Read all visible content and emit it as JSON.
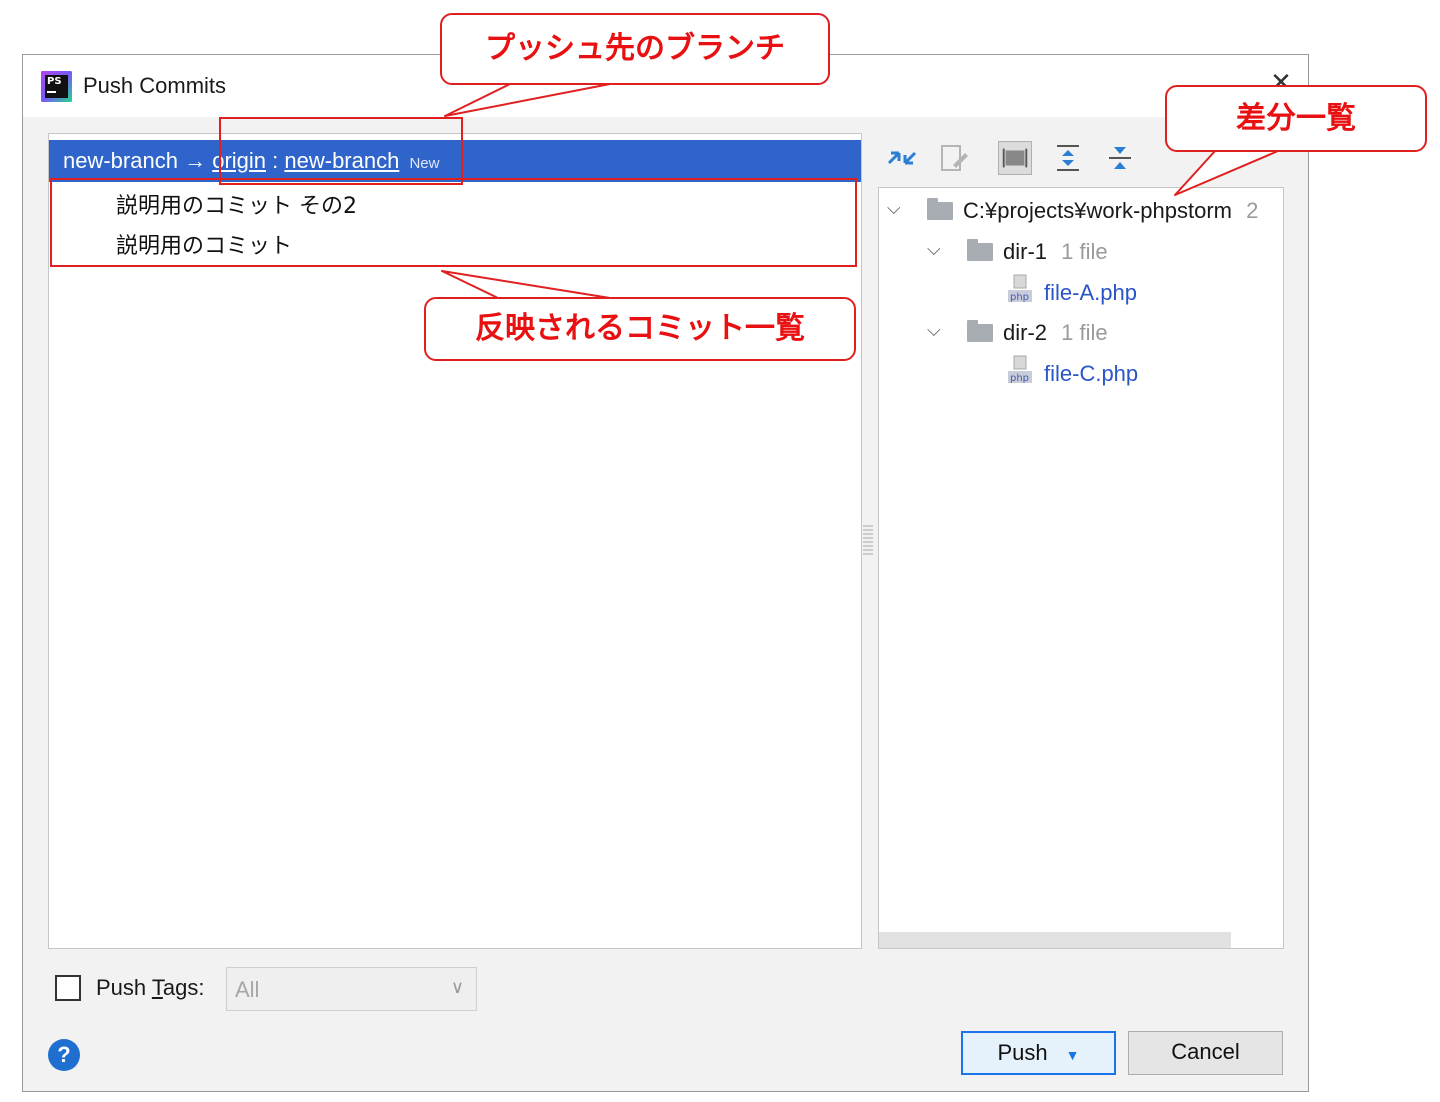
{
  "window": {
    "title": "Push Commits",
    "close": "✕",
    "app_icon": "phpstorm-logo"
  },
  "branch": {
    "local": "new-branch",
    "arrow": "→",
    "remote": "origin",
    "separator": ":",
    "target": "new-branch",
    "badge": "New"
  },
  "commits": [
    {
      "message": "説明用のコミット その2"
    },
    {
      "message": "説明用のコミット"
    }
  ],
  "toolbar": {
    "icons": [
      "show-diff-icon",
      "edit-source-icon",
      "group-by-directory-icon",
      "expand-all-icon",
      "collapse-all-icon"
    ]
  },
  "tree": {
    "root": {
      "label": "C:¥projects¥work-phpstorm",
      "count": "2"
    },
    "dirs": [
      {
        "label": "dir-1",
        "count": "1 file",
        "file": "file-A.php"
      },
      {
        "label": "dir-2",
        "count": "1 file",
        "file": "file-C.php"
      }
    ]
  },
  "push_tags": {
    "label_prefix": "Push ",
    "label_mnemonic": "T",
    "label_suffix": "ags:",
    "value": "All",
    "checked": false
  },
  "buttons": {
    "help": "?",
    "push": "Push",
    "push_dropdown": "▼",
    "cancel": "Cancel"
  },
  "callouts": {
    "target_branch": "プッシュ先のブランチ",
    "diff_list": "差分一覧",
    "commit_list": "反映されるコミット一覧"
  },
  "colors": {
    "selection": "#2f65ca",
    "annotation": "#e02020",
    "link": "#2a55c7"
  }
}
